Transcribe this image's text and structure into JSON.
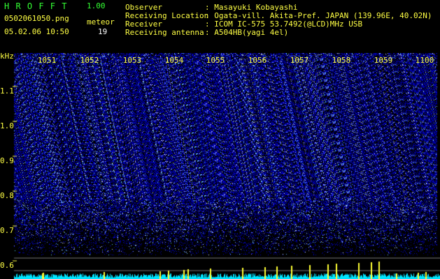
{
  "header": {
    "app_name": "H R O F F T",
    "app_version": "1.00",
    "filename": "0502061050.png",
    "datetime": "05.02.06 10:50",
    "meteor_label": "meteor",
    "meteor_count": "19",
    "info_labels": {
      "observer": "Observer",
      "location": "Receiving Location",
      "receiver": "Receiver",
      "antenna": "Receiving antenna"
    },
    "info_values": {
      "observer": ": Masayuki Kobayashi",
      "location": ": Ogata-vill. Akita-Pref. JAPAN (139.96E, 40.02N)",
      "receiver": ": ICOM IC-575 53.7492(@LCD)MHz USB",
      "antenna": ": A504HB(yagi 4el)"
    }
  },
  "colors": {
    "label_green": "#33ff33",
    "label_yellow": "#ffff44",
    "background": "#000000",
    "spectrogram_blue": "#1a1aff",
    "spectrum_trace": "#00ffff"
  },
  "y_axis": {
    "unit": "kHz",
    "ticks": [
      "1.1",
      "1.0",
      "0.9",
      "0.8",
      "0.7",
      "0.6"
    ]
  },
  "x_axis": {
    "ticks": [
      "1051",
      "1052",
      "1053",
      "1054",
      "1055",
      "1056",
      "1057",
      "1058",
      "1059",
      "1100"
    ]
  }
}
